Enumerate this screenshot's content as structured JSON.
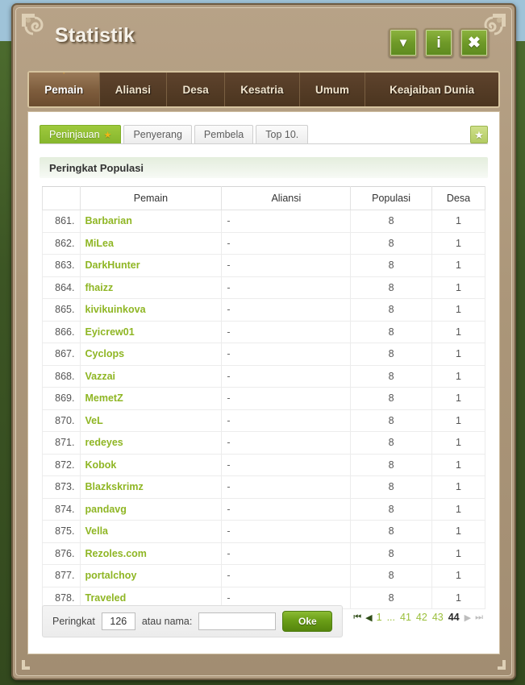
{
  "window": {
    "title": "Statistik",
    "buttons": [
      {
        "name": "collapse-button",
        "glyph": "▼"
      },
      {
        "name": "info-button",
        "glyph": "i"
      },
      {
        "name": "close-button",
        "glyph": "✖"
      }
    ]
  },
  "main_tabs": [
    {
      "label": "Pemain",
      "active": true
    },
    {
      "label": "Aliansi",
      "active": false
    },
    {
      "label": "Desa",
      "active": false
    },
    {
      "label": "Kesatria",
      "active": false
    },
    {
      "label": "Umum",
      "active": false
    },
    {
      "label": "Keajaiban Dunia",
      "active": false
    }
  ],
  "sub_tabs": [
    {
      "label": "Peninjauan",
      "active": true,
      "star": "★"
    },
    {
      "label": "Penyerang",
      "active": false
    },
    {
      "label": "Pembela",
      "active": false
    },
    {
      "label": "Top 10.",
      "active": false
    }
  ],
  "favorite_button": {
    "glyph": "★"
  },
  "section": {
    "title": "Peringkat Populasi"
  },
  "table": {
    "headers": [
      "",
      "Pemain",
      "Aliansi",
      "Populasi",
      "Desa"
    ],
    "rows": [
      {
        "rank": "861.",
        "player": "Barbarian",
        "alliance": "-",
        "population": "8",
        "villages": "1"
      },
      {
        "rank": "862.",
        "player": "MiLea",
        "alliance": "-",
        "population": "8",
        "villages": "1"
      },
      {
        "rank": "863.",
        "player": "DarkHunter",
        "alliance": "-",
        "population": "8",
        "villages": "1"
      },
      {
        "rank": "864.",
        "player": "fhaizz",
        "alliance": "-",
        "population": "8",
        "villages": "1"
      },
      {
        "rank": "865.",
        "player": "kivikuinkova",
        "alliance": "-",
        "population": "8",
        "villages": "1"
      },
      {
        "rank": "866.",
        "player": "Eyicrew01",
        "alliance": "-",
        "population": "8",
        "villages": "1"
      },
      {
        "rank": "867.",
        "player": "Cyclops",
        "alliance": "-",
        "population": "8",
        "villages": "1"
      },
      {
        "rank": "868.",
        "player": "Vazzai",
        "alliance": "-",
        "population": "8",
        "villages": "1"
      },
      {
        "rank": "869.",
        "player": "MemetZ",
        "alliance": "-",
        "population": "8",
        "villages": "1"
      },
      {
        "rank": "870.",
        "player": "VeL",
        "alliance": "-",
        "population": "8",
        "villages": "1"
      },
      {
        "rank": "871.",
        "player": "redeyes",
        "alliance": "-",
        "population": "8",
        "villages": "1"
      },
      {
        "rank": "872.",
        "player": "Kobok",
        "alliance": "-",
        "population": "8",
        "villages": "1"
      },
      {
        "rank": "873.",
        "player": "Blazkskrimz",
        "alliance": "-",
        "population": "8",
        "villages": "1"
      },
      {
        "rank": "874.",
        "player": "pandavg",
        "alliance": "-",
        "population": "8",
        "villages": "1"
      },
      {
        "rank": "875.",
        "player": "Vella",
        "alliance": "-",
        "population": "8",
        "villages": "1"
      },
      {
        "rank": "876.",
        "player": "Rezoles.com",
        "alliance": "-",
        "population": "8",
        "villages": "1"
      },
      {
        "rank": "877.",
        "player": "portalchoy",
        "alliance": "-",
        "population": "8",
        "villages": "1"
      },
      {
        "rank": "878.",
        "player": "Traveled",
        "alliance": "-",
        "population": "8",
        "villages": "1"
      }
    ]
  },
  "search": {
    "rank_label": "Peringkat",
    "rank_value": "126",
    "name_label": "atau nama:",
    "name_value": "",
    "name_placeholder": "",
    "submit_label": "Oke"
  },
  "pagination": {
    "first": "⏮",
    "prev": "◀",
    "next": "▶",
    "last": "⏭",
    "pages": [
      {
        "label": "1",
        "current": false,
        "type": "page"
      },
      {
        "label": "...",
        "current": false,
        "type": "dots"
      },
      {
        "label": "41",
        "current": false,
        "type": "page"
      },
      {
        "label": "42",
        "current": false,
        "type": "page"
      },
      {
        "label": "43",
        "current": false,
        "type": "page"
      },
      {
        "label": "44",
        "current": true,
        "type": "page"
      }
    ]
  },
  "colors": {
    "frame": "#ab9679",
    "tab_bar": "#4b351f",
    "accent_green": "#8fb624",
    "subtab_active": "#96c235",
    "link": "#8fb624"
  }
}
